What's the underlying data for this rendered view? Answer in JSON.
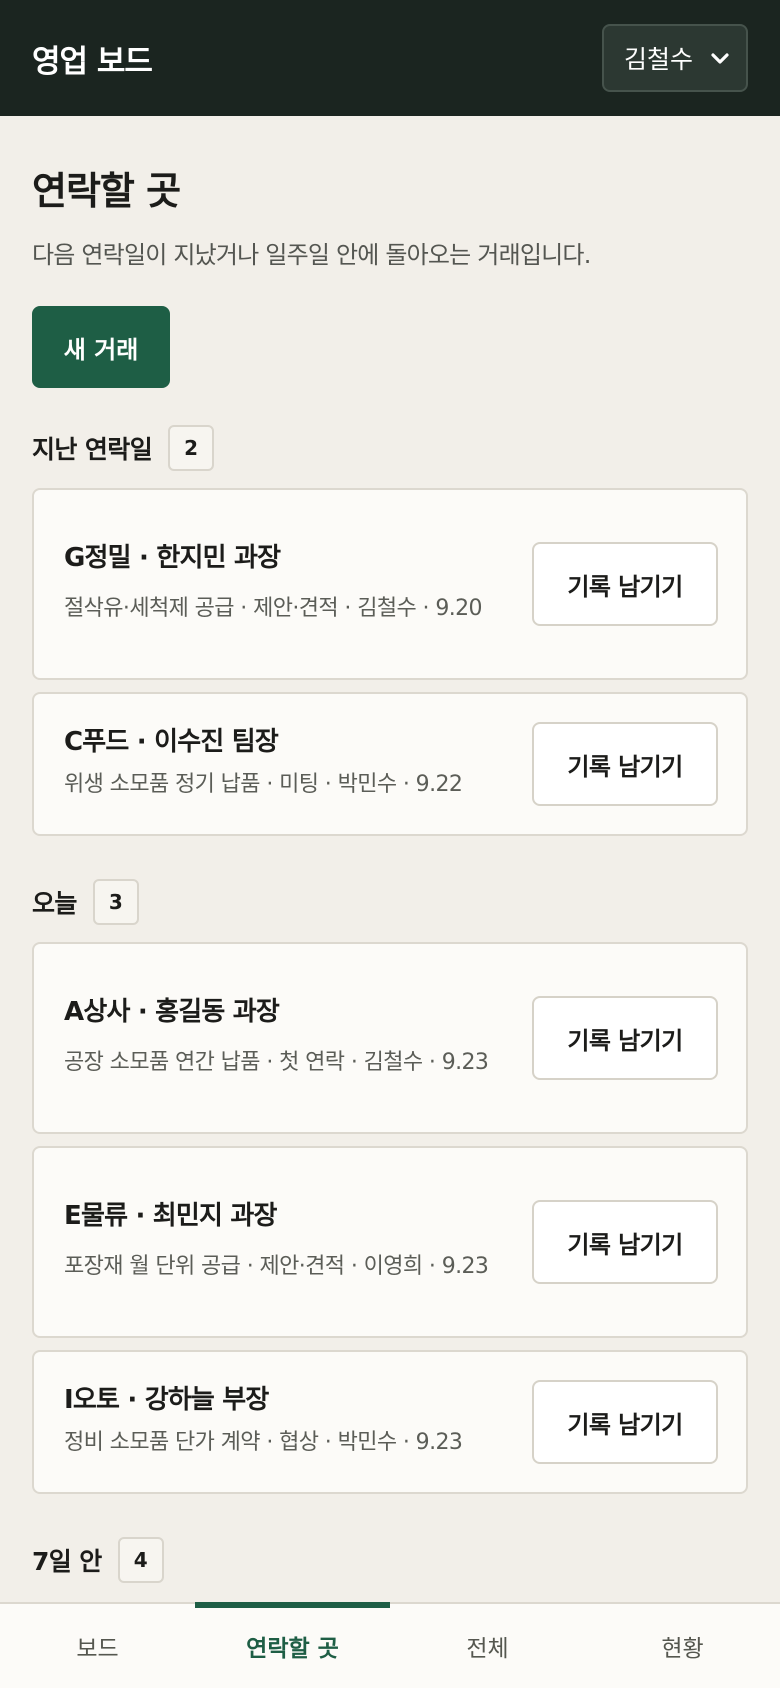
{
  "header": {
    "title": "영업 보드",
    "user_select": "김철수"
  },
  "page": {
    "title": "연락할 곳",
    "subtitle": "다음 연락일이 지났거나 일주일 안에 돌아오는 거래입니다.",
    "new_deal_label": "새 거래"
  },
  "action_label": "기록 남기기",
  "sections": [
    {
      "title": "지난 연락일",
      "count": "2",
      "cards": [
        {
          "title": "G정밀 · 한지민 과장",
          "meta": "절삭유·세척제 공급 · 제안·견적 · 김철수 · 9.20"
        },
        {
          "title": "C푸드 · 이수진 팀장",
          "meta": "위생 소모품 정기 납품 · 미팅 · 박민수 · 9.22"
        }
      ]
    },
    {
      "title": "오늘",
      "count": "3",
      "cards": [
        {
          "title": "A상사 · 홍길동 과장",
          "meta": "공장 소모품 연간 납품 · 첫 연락 · 김철수 · 9.23"
        },
        {
          "title": "E물류 · 최민지 과장",
          "meta": "포장재 월 단위 공급 · 제안·견적 · 이영희 · 9.23"
        },
        {
          "title": "I오토 · 강하늘 부장",
          "meta": "정비 소모품 단가 계약 · 협상 · 박민수 · 9.23"
        }
      ]
    },
    {
      "title": "7일 안",
      "count": "4",
      "cards": []
    }
  ],
  "nav": {
    "tabs": [
      "보드",
      "연락할 곳",
      "전체",
      "현황"
    ],
    "active": "연락할 곳"
  },
  "colors": {
    "topbar": "#1b2520",
    "accent": "#1e5e45",
    "background": "#f2efe9",
    "card": "#fcfbf8"
  }
}
